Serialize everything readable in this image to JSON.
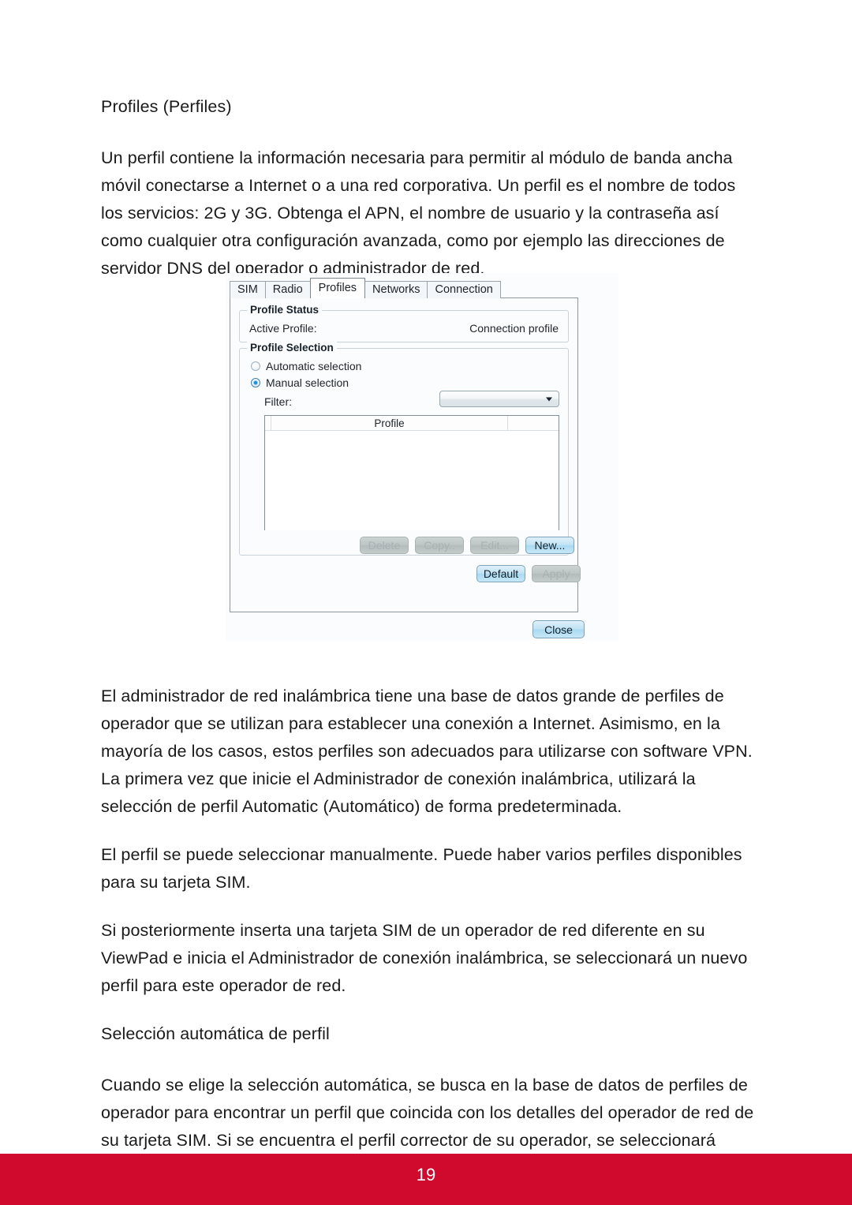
{
  "document": {
    "heading": "Profiles (Perfiles)",
    "paragraphs": [
      "Un perfil contiene la información necesaria para permitir al módulo de banda ancha móvil conectarse a Internet o a una red corporativa. Un perfil es el nombre de todos los servicios: 2G y 3G. Obtenga el APN, el nombre de usuario y la contraseña así como cualquier otra configuración avanzada, como por ejemplo las direcciones de servidor DNS del operador o administrador de red.",
      "El administrador de red inalámbrica tiene una base de datos grande de perfiles de operador que se utilizan para establecer una conexión a Internet. Asimismo, en la mayoría de los casos, estos perfiles son adecuados para utilizarse con software VPN. La primera vez que inicie el Administrador de conexión inalámbrica, utilizará la selección de perfil Automatic (Automático) de forma predeterminada.",
      "El perfil se puede seleccionar manualmente. Puede haber varios perfiles disponibles para su tarjeta SIM.",
      "Si posteriormente inserta una tarjeta SIM de un operador de red diferente en su ViewPad e inicia el Administrador de conexión inalámbrica, se seleccionará un nuevo perfil para este operador de red."
    ],
    "subheading": "Selección automática de perfil",
    "final_paragraph": "Cuando se elige la selección automática, se busca en la base de datos de perfiles de operador para encontrar un perfil que coincida con los detalles del operador de red de su tarjeta SIM. Si se encuentra el perfil corrector de su operador, se seleccionará como su selección automática."
  },
  "figure": {
    "tabs": [
      {
        "label": "SIM",
        "active": false
      },
      {
        "label": "Radio",
        "active": false
      },
      {
        "label": "Profiles",
        "active": true
      },
      {
        "label": "Networks",
        "active": false
      },
      {
        "label": "Connection",
        "active": false
      }
    ],
    "profile_status": {
      "group_title": "Profile Status",
      "active_profile_label": "Active Profile:",
      "active_profile_value": "Connection profile"
    },
    "profile_selection": {
      "group_title": "Profile Selection",
      "automatic_label": "Automatic selection",
      "automatic_checked": false,
      "manual_label": "Manual selection",
      "manual_checked": true,
      "filter_label": "Filter:",
      "filter_value": "",
      "filter_arrow_icon": "chevron-down-icon"
    },
    "profile_table": {
      "columns": [
        "",
        "Profile",
        ""
      ],
      "rows": []
    },
    "buttons": {
      "delete": "Delete",
      "copy": "Copy..",
      "edit": "Edit...",
      "new": "New...",
      "default": "Default",
      "apply": "Apply",
      "close": "Close"
    }
  },
  "footer": {
    "page_number": "19",
    "band_color": "#cf0a2c"
  }
}
